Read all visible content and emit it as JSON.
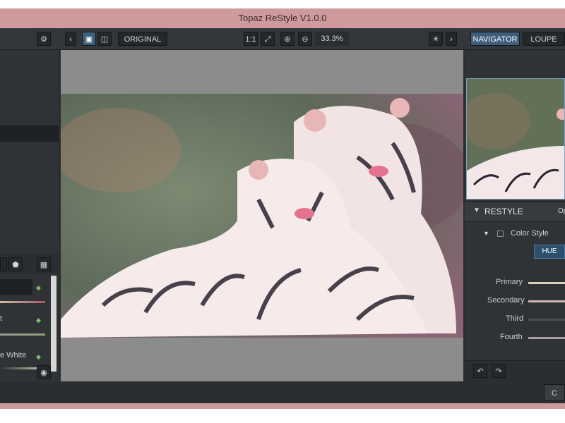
{
  "window": {
    "title": "Topaz ReStyle V1.0.0"
  },
  "toolbar": {
    "original_label": "ORIGINAL",
    "ratio_label": "1:1",
    "zoom_label": "33.3%"
  },
  "left_panel": {
    "item_labels": [
      "t",
      "e White"
    ]
  },
  "right_panel": {
    "tabs": [
      "NAVIGATOR",
      "LOUPE"
    ],
    "section_title": "RESTYLE",
    "section_right_text": "Op",
    "color_style_label": "Color Style",
    "hue_button": "HUE",
    "sliders": [
      {
        "label": "Primary",
        "value": 0.55
      },
      {
        "label": "Secondary",
        "value": 0.6
      },
      {
        "label": "Third",
        "value": 0.4
      },
      {
        "label": "Fourth",
        "value": 0.5
      }
    ]
  },
  "statusbar": {
    "right_button": "C"
  },
  "colors": {
    "window_border": "#cf9a9c",
    "panel_bg": "#2f3336",
    "accent": "#3e5e7c"
  }
}
